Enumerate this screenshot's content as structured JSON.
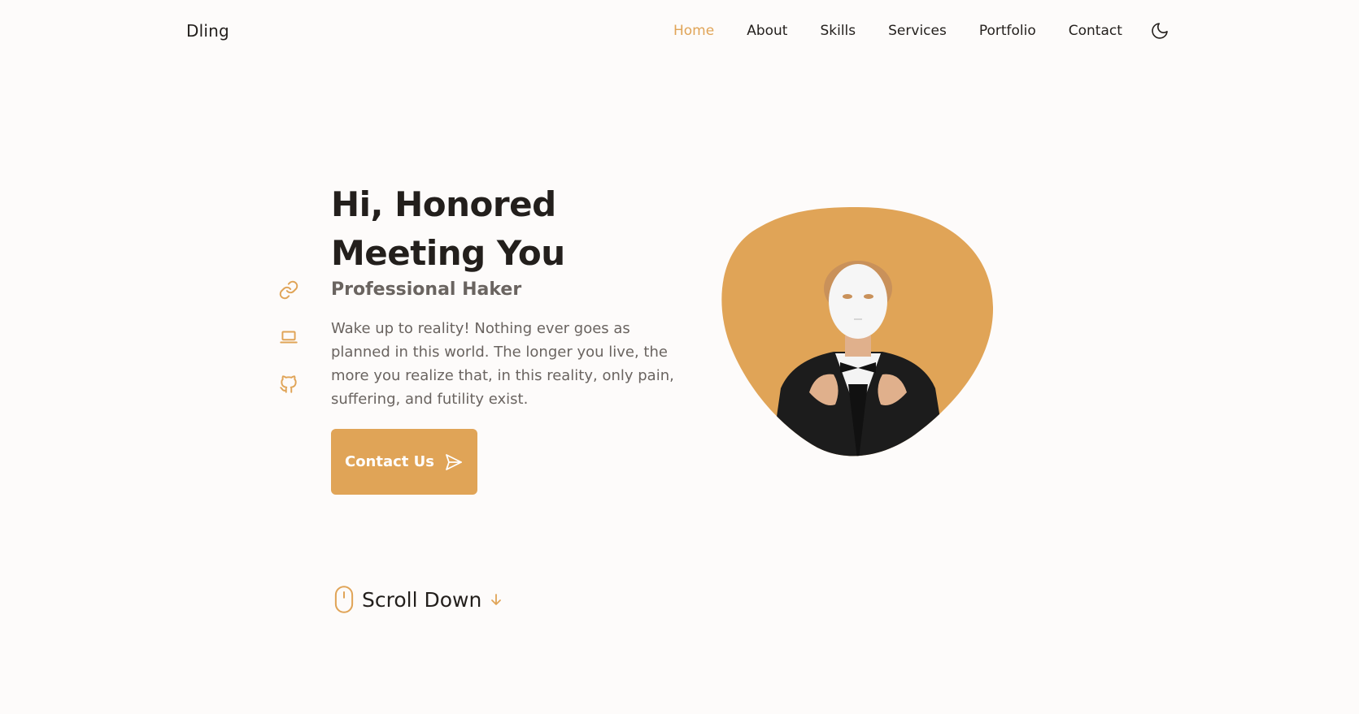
{
  "brand": {
    "logo": "Dling"
  },
  "nav": {
    "items": [
      {
        "label": "Home",
        "active": true
      },
      {
        "label": "About",
        "active": false
      },
      {
        "label": "Skills",
        "active": false
      },
      {
        "label": "Services",
        "active": false
      },
      {
        "label": "Portfolio",
        "active": false
      },
      {
        "label": "Contact",
        "active": false
      }
    ],
    "theme_toggle_icon": "moon-icon"
  },
  "social": [
    {
      "icon": "link-icon"
    },
    {
      "icon": "laptop-icon"
    },
    {
      "icon": "github-icon"
    }
  ],
  "hero": {
    "title": "Hi, Honored Meeting You",
    "subtitle": "Professional Haker",
    "description": "Wake up to reality! Nothing ever goes as planned in this world. The longer you live, the more you realize that, in this reality, only pain, suffering, and futility exist.",
    "cta_label": "Contact Us",
    "cta_icon": "send-icon",
    "image_icon": "masked-man-portrait"
  },
  "scroll": {
    "label": "Scroll Down",
    "icon": "mouse-icon",
    "arrow_icon": "arrow-down-icon"
  },
  "colors": {
    "accent": "#e0a457",
    "text_dark": "#231f1c",
    "text_muted": "#6a6460",
    "background": "#fdfbfa"
  }
}
